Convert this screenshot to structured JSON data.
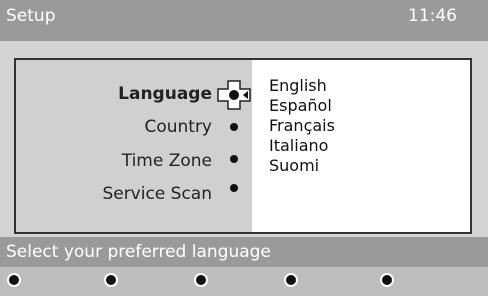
{
  "header": {
    "title": "Setup",
    "clock": "11:46"
  },
  "menu": {
    "items": [
      {
        "label": "Language",
        "selected": true
      },
      {
        "label": "Country"
      },
      {
        "label": "Time Zone"
      },
      {
        "label": "Service Scan"
      }
    ]
  },
  "options": [
    "English",
    "Español",
    "Français",
    "Italiano",
    "Suomi"
  ],
  "status": {
    "text": "Select your preferred language"
  },
  "colors": {
    "bar": "#9a9a9a",
    "menu": "#d0d0d0"
  },
  "footer_buttons": [
    "colored-button",
    "colored-button",
    "colored-button",
    "colored-button",
    "colored-button"
  ]
}
